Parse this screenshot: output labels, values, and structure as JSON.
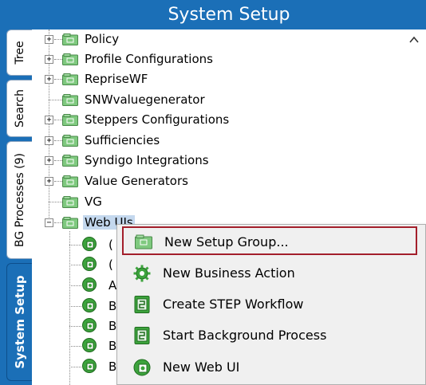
{
  "header": {
    "title": "System Setup"
  },
  "tabs": [
    {
      "label": "Tree",
      "active": false
    },
    {
      "label": "Search",
      "active": false
    },
    {
      "label": "BG Processes (9)",
      "active": false
    },
    {
      "label": "System Setup",
      "active": true
    }
  ],
  "tree": {
    "items": [
      {
        "label": "Policy",
        "expandable": true
      },
      {
        "label": "Profile Configurations",
        "expandable": true
      },
      {
        "label": "RepriseWF",
        "expandable": true
      },
      {
        "label": "SNWvaluegenerator",
        "expandable": false
      },
      {
        "label": "Steppers Configurations",
        "expandable": true
      },
      {
        "label": "Sufficiencies",
        "expandable": true
      },
      {
        "label": "Syndigo Integrations",
        "expandable": true
      },
      {
        "label": "Value Generators",
        "expandable": true
      },
      {
        "label": "VG",
        "expandable": false
      },
      {
        "label": "Web UIs",
        "expandable": true,
        "expanded": true,
        "selected": true
      }
    ],
    "children_partial": [
      "(",
      "(",
      "A",
      "B",
      "B",
      "B",
      "B"
    ]
  },
  "context_menu": {
    "items": [
      {
        "label": "New Setup Group...",
        "icon": "setup-group-icon",
        "highlighted": true
      },
      {
        "label": "New Business Action",
        "icon": "business-action-gear-icon",
        "highlighted": false
      },
      {
        "label": "Create STEP Workflow",
        "icon": "workflow-icon",
        "highlighted": false
      },
      {
        "label": "Start Background Process",
        "icon": "background-process-icon",
        "highlighted": false
      },
      {
        "label": "New Web UI",
        "icon": "web-ui-globe-icon",
        "highlighted": false
      }
    ]
  },
  "colors": {
    "accent_blue": "#1b6fb7",
    "highlight_border": "#a31f2b",
    "selection": "#c4d8ee",
    "folder_green": "#7fc97f"
  }
}
